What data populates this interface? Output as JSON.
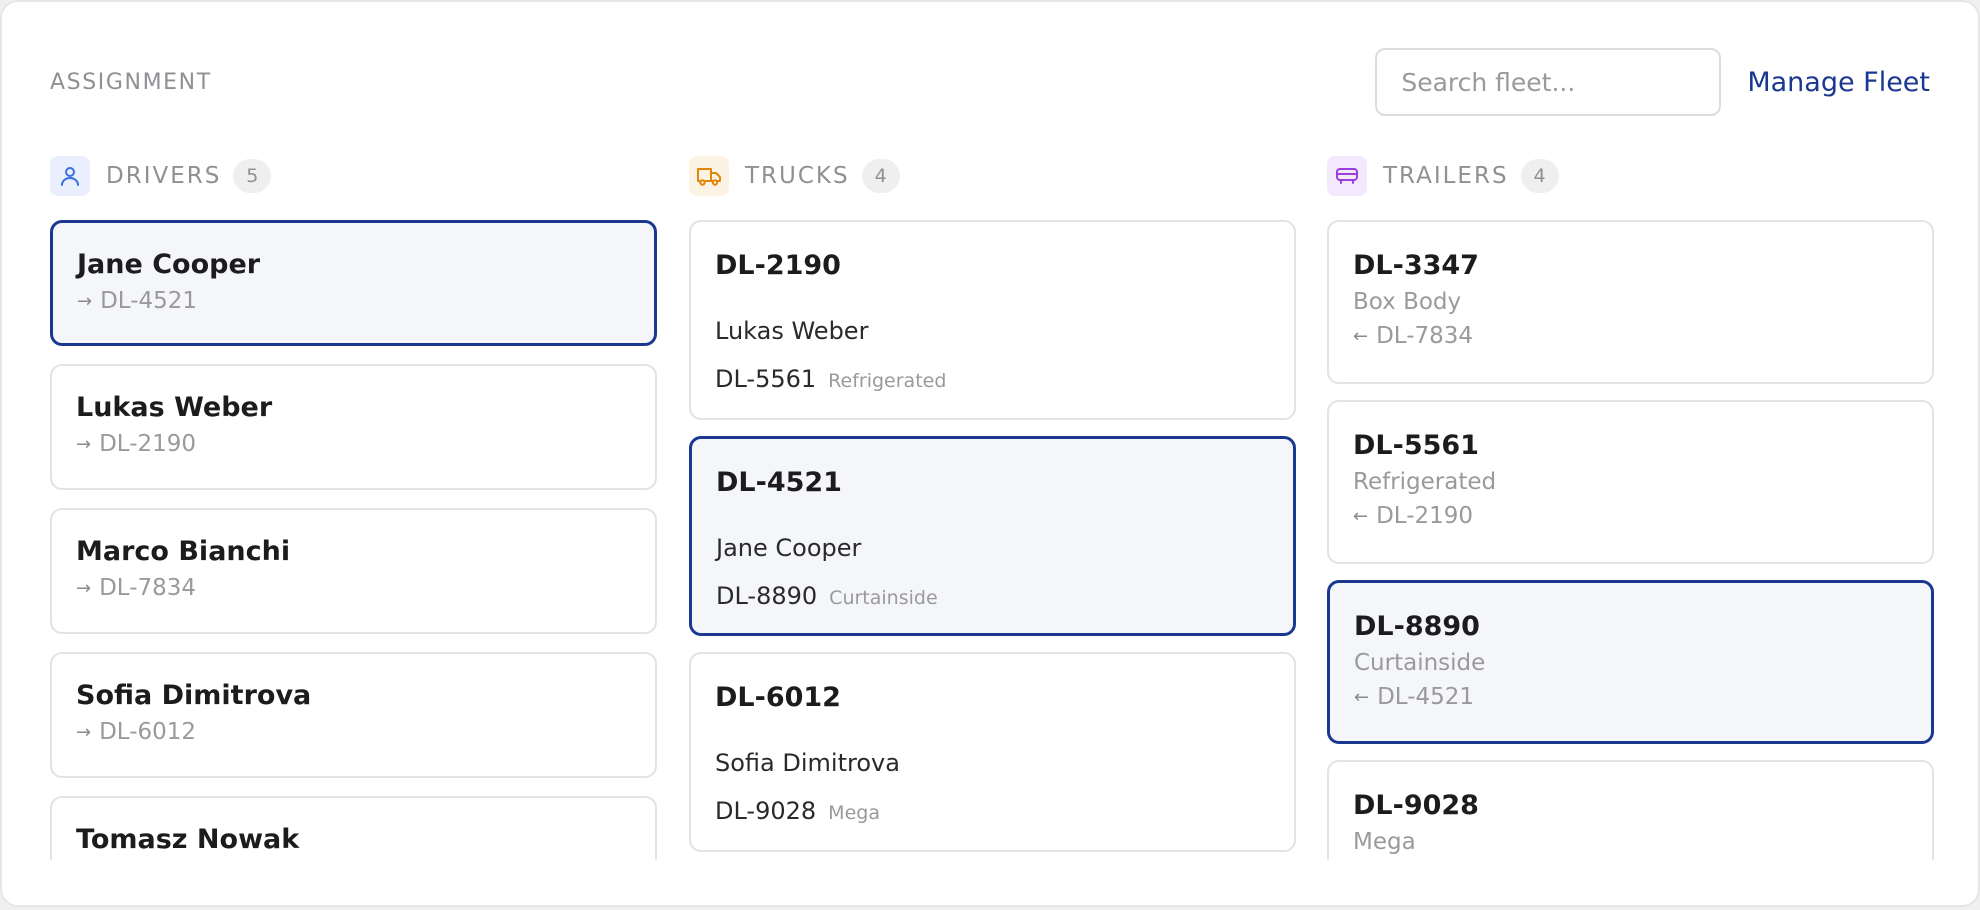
{
  "header": {
    "title": "ASSIGNMENT",
    "search_placeholder": "Search fleet...",
    "manage_label": "Manage Fleet"
  },
  "columns": {
    "drivers": {
      "label": "DRIVERS",
      "count": "5",
      "icon": "user-icon",
      "items": [
        {
          "name": "Jane Cooper",
          "truck": "DL-4521",
          "selected": true
        },
        {
          "name": "Lukas Weber",
          "truck": "DL-2190",
          "selected": false
        },
        {
          "name": "Marco Bianchi",
          "truck": "DL-7834",
          "selected": false
        },
        {
          "name": "Sofia Dimitrova",
          "truck": "DL-6012",
          "selected": false
        },
        {
          "name": "Tomasz Nowak",
          "truck": "",
          "selected": false
        }
      ]
    },
    "trucks": {
      "label": "TRUCKS",
      "count": "4",
      "icon": "truck-icon",
      "items": [
        {
          "id": "DL-2190",
          "driver": "Lukas Weber",
          "trailer": "DL-5561",
          "trailer_type": "Refrigerated",
          "selected": false
        },
        {
          "id": "DL-4521",
          "driver": "Jane Cooper",
          "trailer": "DL-8890",
          "trailer_type": "Curtainside",
          "selected": true
        },
        {
          "id": "DL-6012",
          "driver": "Sofia Dimitrova",
          "trailer": "DL-9028",
          "trailer_type": "Mega",
          "selected": false
        }
      ]
    },
    "trailers": {
      "label": "TRAILERS",
      "count": "4",
      "icon": "trailer-icon",
      "items": [
        {
          "id": "DL-3347",
          "type": "Box Body",
          "truck": "DL-7834",
          "selected": false
        },
        {
          "id": "DL-5561",
          "type": "Refrigerated",
          "truck": "DL-2190",
          "selected": false
        },
        {
          "id": "DL-8890",
          "type": "Curtainside",
          "truck": "DL-4521",
          "selected": true
        },
        {
          "id": "DL-9028",
          "type": "Mega",
          "truck": "",
          "selected": false
        }
      ]
    }
  },
  "colors": {
    "accent": "#1b3891",
    "driver_icon": "#3b6fe0",
    "truck_icon": "#e0860b",
    "trailer_icon": "#9b3fe0",
    "selected_bg": "#f4f6fa"
  }
}
